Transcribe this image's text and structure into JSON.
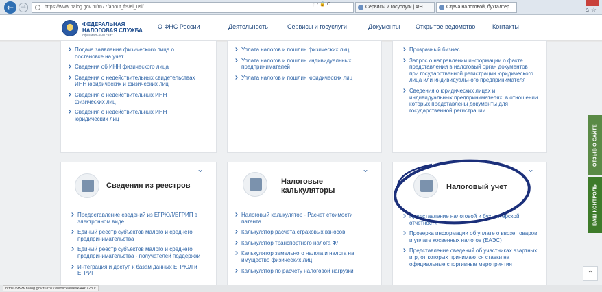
{
  "browser": {
    "url": "https://www.nalog.gov.ru/rn77/about_fts/el_usl/",
    "url_tools": "ρ - 🔒 C",
    "tabs": [
      {
        "label": "Сервисы и госуслуги | ФН..."
      },
      {
        "label": "Сдача налоговой, бухгалтер..."
      }
    ],
    "status_url": "https://www.nalog.gov.ru/rn77/service/eaesk/4467280/"
  },
  "header": {
    "brand_line1": "ФЕДЕРАЛЬНАЯ",
    "brand_line2": "НАЛОГОВАЯ СЛУЖБА",
    "brand_sub": "официальный сайт",
    "nav": [
      "О ФНС России",
      "Деятельность",
      "Сервисы и госуслуги",
      "Документы",
      "Открытое ведомство",
      "Контакты"
    ]
  },
  "top_cards": [
    {
      "items": [
        "Подача заявления физического лица о постановке на учет",
        "Сведения об ИНН физического лица",
        "Сведения о недействительных свидетельствах ИНН юридических и физических лиц",
        "Сведения о недействительных ИНН физических лиц",
        "Сведения о недействительных ИНН юридических лиц"
      ]
    },
    {
      "items": [
        "Уплата налогов и пошлин физических лиц",
        "Уплата налогов и пошлин индивидуальных предпринимателей",
        "Уплата налогов и пошлин юридических лиц"
      ]
    },
    {
      "items": [
        "Прозрачный бизнес",
        "Запрос о направлении информации о факте представления в налоговый орган документов при государственной регистрации юридического лица или индивидуального предпринимателя",
        "Сведения о юридических лицах и индивидуальных предпринимателях, в отношении которых представлены документы для государственной регистрации"
      ]
    }
  ],
  "bottom_cards": [
    {
      "title": "Сведения из реестров",
      "items": [
        "Предоставление сведений из ЕГРЮЛ/ЕГРИП в электронном виде",
        "Единый реестр субъектов малого и среднего предпринимательства",
        "Единый реестр субъектов малого и среднего предпринимательства - получателей поддержки",
        "Интеграция и доступ к базам данных ЕГРЮЛ и ЕГРИП"
      ]
    },
    {
      "title": "Налоговые калькуляторы",
      "items": [
        "Налоговый калькулятор - Расчет стоимости патента",
        "Калькулятор расчёта страховых взносов",
        "Калькулятор транспортного налога ФЛ",
        "Калькулятор земельного налога и налога на имущество физических лиц",
        "Калькулятор по расчету налоговой нагрузки"
      ]
    },
    {
      "title": "Налоговый учет",
      "items": [
        "Представление налоговой и бухгалтерской отчетности",
        "Проверка информации об уплате о ввозе товаров и уплате косвенных налогов (ЕАЭС)",
        "Представление сведений об участниках азартных игр, от которых принимаются ставки на официальные спортивные мероприятия"
      ]
    }
  ],
  "side_tabs": {
    "feedback": "ОТЗЫВ О САЙТЕ",
    "control": "ВАШ КОНТРОЛЬ"
  },
  "colors": {
    "link": "#2d63a6",
    "annotation_circle": "#1b2f7a",
    "feedback_tab": "#5a8a46",
    "control_tab": "#3e7b2a"
  },
  "icons": {
    "back": "arrow-left",
    "chevron": "chevron-down",
    "scroll_top": "chevron-up"
  }
}
